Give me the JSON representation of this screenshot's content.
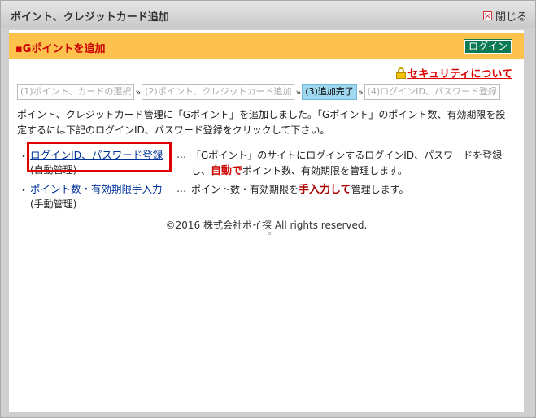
{
  "window": {
    "title": "ポイント、クレジットカード追加",
    "close_label": "閉じる"
  },
  "header": {
    "title": "▪Gポイントを追加",
    "login_label": "ログイン"
  },
  "security_link": "セキュリティについて",
  "steps": [
    {
      "label": "(1)ポイント、カードの選択",
      "active": false
    },
    {
      "label": "(2)ポイント、クレジットカード追加",
      "active": false
    },
    {
      "label": "(3)追加完了",
      "active": true
    },
    {
      "label": "(4)ログインID、パスワード登録",
      "active": false
    }
  ],
  "step_separator": "»",
  "description": "ポイント、クレジットカード管理に「Gポイント」を追加しました。「Gポイント」のポイント数、有効期限を設定するには下記のログインID、パスワード登録をクリックして下さい。",
  "options": [
    {
      "bullet": "・",
      "link": "ログインID、パスワード登録",
      "sub": "(自動管理)",
      "ellipsis": "…",
      "text_before": "「Gポイント」のサイトにログインするログインID、パスワードを登録し、",
      "highlight": "自動で",
      "text_after": "ポイント数、有効期限を管理します。"
    },
    {
      "bullet": "・",
      "link": "ポイント数・有効期限手入力",
      "sub": "(手動管理)",
      "ellipsis": "…",
      "text_before": "ポイント数・有効期限を",
      "highlight": "手入力して",
      "text_after": "管理します。"
    }
  ],
  "footer": "©2016 株式会社ポイ探 All rights reserved.",
  "colors": {
    "header_bg": "#fdc24e",
    "header_title": "#cc0000",
    "login_bg": "#0b7a54",
    "active_step": "#9fd8ef",
    "link": "#003399",
    "highlight_box": "#e00000"
  }
}
